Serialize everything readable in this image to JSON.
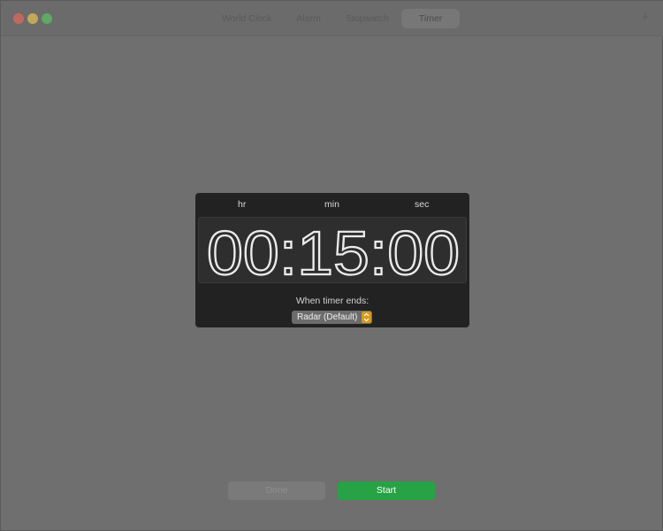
{
  "tabs": [
    {
      "label": "World Clock",
      "active": false
    },
    {
      "label": "Alarm",
      "active": false
    },
    {
      "label": "Stopwatch",
      "active": false
    },
    {
      "label": "Timer",
      "active": true
    }
  ],
  "timer": {
    "units": {
      "hr": "hr",
      "min": "min",
      "sec": "sec"
    },
    "display": "00:15:00",
    "ends_label": "When timer ends:",
    "sound": "Radar (Default)"
  },
  "buttons": {
    "done": "Done",
    "start": "Start"
  },
  "icons": {
    "add": "plus-icon",
    "stepper": "up-down-stepper-icon"
  },
  "colors": {
    "start_green": "#27a244",
    "stepper_orange": "#d79a1a",
    "close": "#c0685f",
    "minimize": "#c4a85a",
    "zoom": "#5fa866"
  }
}
